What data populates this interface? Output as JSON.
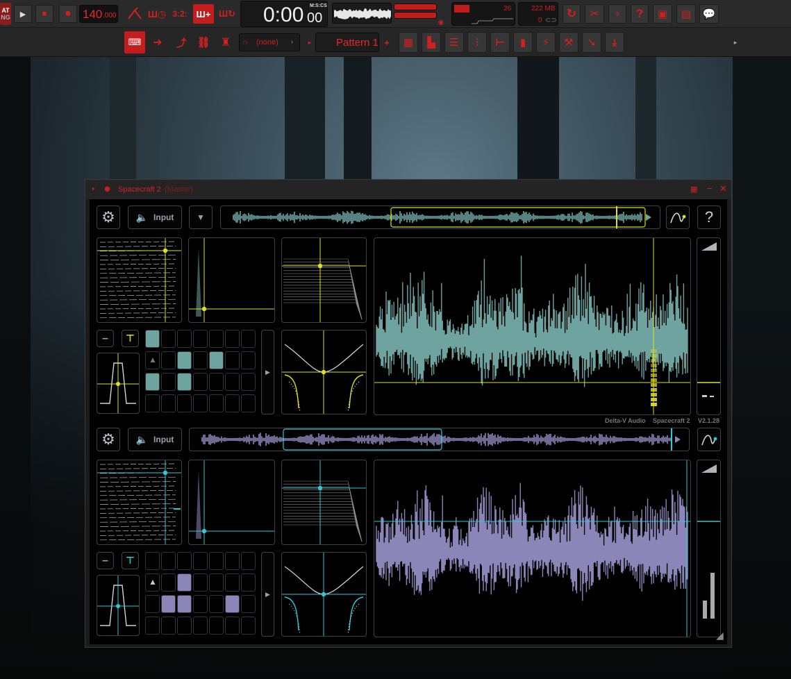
{
  "daw": {
    "mode_badge_top": "AT",
    "mode_badge_bottom": "NG",
    "tempo": "140",
    "tempo_decimal": ".000",
    "time_main": "0:00",
    "time_sub": "00",
    "time_format": "M:S:CS",
    "cpu_value": "26",
    "memory": "222 MB",
    "polyphony": "0",
    "pattern_name": "Pattern 1",
    "channel_select": "(none)",
    "colors": {
      "accent": "#e52a2a",
      "toolbar": "#2a2a2a"
    }
  },
  "plugin": {
    "window_title": "Spacecraft 2",
    "window_subtitle": "(Master)",
    "vendor": "Delta-V Audio",
    "product": "Spacecraft 2",
    "version": "V2.1.28",
    "deck_top": {
      "input_label": "Input",
      "accent": "#e0e020",
      "wave_color": "#6fa3a0",
      "grain_progress": 0.1
    },
    "deck_bottom": {
      "input_label": "Input",
      "accent": "#33c8d6",
      "wave_color": "#8c85b8",
      "grain_progress": 0.85
    },
    "help_label": "?"
  }
}
